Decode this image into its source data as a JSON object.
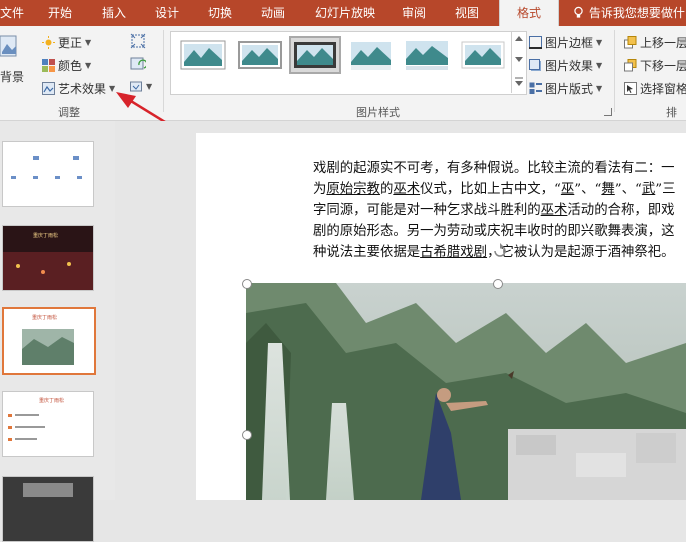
{
  "tabs": [
    {
      "label": "文件"
    },
    {
      "label": "开始"
    },
    {
      "label": "插入"
    },
    {
      "label": "设计"
    },
    {
      "label": "切换"
    },
    {
      "label": "动画"
    },
    {
      "label": "幻灯片放映"
    },
    {
      "label": "审阅"
    },
    {
      "label": "视图"
    },
    {
      "label": "格式"
    }
  ],
  "tell_me": "告诉我您想要做什",
  "ribbon": {
    "remove_bg": "背景",
    "corrections": "更正",
    "color": "颜色",
    "artistic_effects": "艺术效果",
    "adjust_group": "调整",
    "picture_styles_group": "图片样式",
    "picture_border": "图片边框",
    "picture_effects": "图片效果",
    "picture_layout": "图片版式",
    "bring_forward": "上移一层",
    "send_backward": "下移一层",
    "selection_pane": "选择窗格",
    "arrange_group": "排列"
  },
  "slide_text": {
    "p1": "戏剧的起源实不可考，有多种假说。比较主流的看法有二：一为",
    "link1": "原始宗教",
    "p2": "的",
    "link2": "巫术",
    "p3": "仪式，比如上古中文，“",
    "link3": "巫",
    "p4": "”、“",
    "link4": "舞",
    "p5": "”、“",
    "link5": "武",
    "p6": "”三字同源，可能是对一种乞求战斗胜利的",
    "link6": "巫术",
    "p7": "活动的合称，即戏剧的原始形态。另一为劳动或庆祝丰收时的即兴歌舞表演，这种说法主要依据是",
    "link7": "古希腊戏剧",
    "p8": "，它被认为是起源于酒神祭祀。"
  },
  "thumbnails": [
    {
      "title": ""
    },
    {
      "title": "重庆丁雨松"
    },
    {
      "title": "重庆丁雨松"
    },
    {
      "title": "重庆丁雨松"
    },
    {
      "title": ""
    }
  ],
  "colors": {
    "accent": "#b7472a",
    "arrow": "#d7232a",
    "selection": "#e0773b"
  }
}
